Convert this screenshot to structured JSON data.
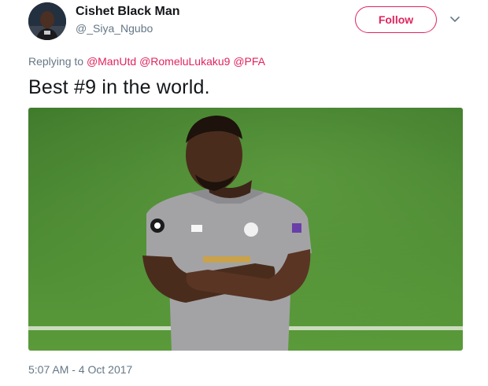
{
  "user": {
    "display_name": "Cishet Black Man",
    "username": "@_Siya_Ngubo",
    "avatar_icon": "profile-photo"
  },
  "follow_label": "Follow",
  "menu_icon": "chevron-down-icon",
  "reply": {
    "prefix": "Replying to",
    "mentions": [
      "@ManUtd",
      "@RomeluLukaku9",
      "@PFA"
    ]
  },
  "tweet_text": "Best #9 in the world.",
  "media": {
    "description_icon": "photo-football-player-arms-crossed"
  },
  "timestamp": "5:07 AM - 4 Oct 2017",
  "colors": {
    "accent": "#e0245e",
    "secondary_text": "#657786",
    "primary_text": "#14171a",
    "pitch_green": "#4f8a33"
  }
}
